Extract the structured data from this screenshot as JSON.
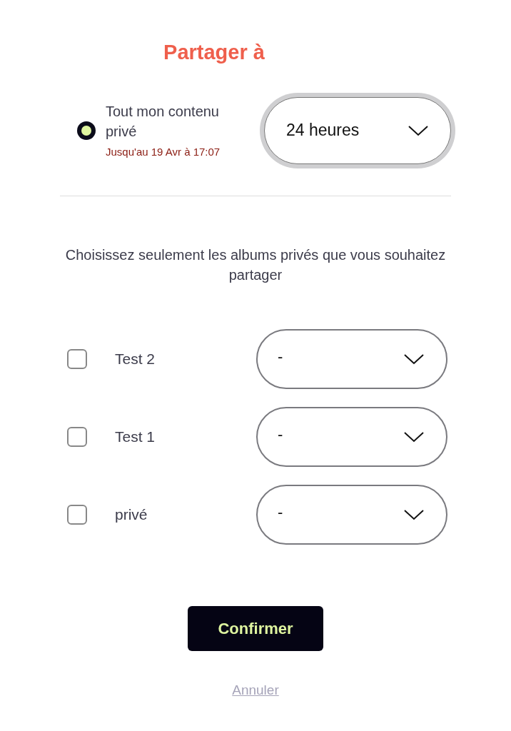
{
  "title": "Partager à",
  "all_content": {
    "label": "Tout mon contenu privé",
    "selected": true,
    "expiry": "Jusqu'au 19 Avr à 17:07",
    "duration": {
      "value": "24 heures",
      "focused": true
    }
  },
  "instructions": "Choisissez seulement les albums privés que vous souhaitez partager",
  "albums": [
    {
      "name": "Test 2",
      "checked": false,
      "duration": "-"
    },
    {
      "name": "Test 1",
      "checked": false,
      "duration": "-"
    },
    {
      "name": "privé",
      "checked": false,
      "duration": "-"
    }
  ],
  "confirm_button": "Confirmer",
  "cancel_link": "Annuler"
}
